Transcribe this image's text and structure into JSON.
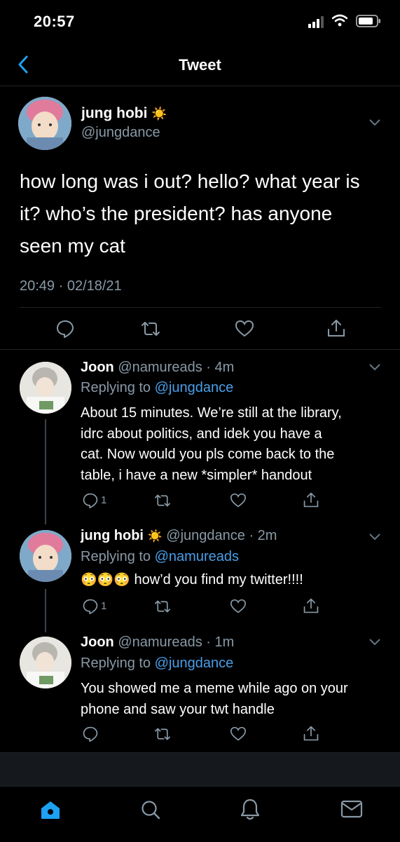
{
  "status_bar": {
    "time": "20:57"
  },
  "header": {
    "title": "Tweet"
  },
  "main_tweet": {
    "author_name": "jung hobi",
    "author_emoji": "☀️",
    "author_handle": "@jungdance",
    "text_lines": [
      "how long was i out? hello? what year is",
      "it? who’s the president? has anyone",
      "seen my cat"
    ],
    "timestamp": "20:49 · 02/18/21"
  },
  "replies": [
    {
      "author_name": "Joon",
      "author_handle": "@namureads",
      "time": "· 4m",
      "replying_prefix": "Replying to",
      "replying_to": "@jungdance",
      "text_lines": [
        "About 15 minutes. We’re still at the library,",
        "idrc about politics, and idek you have a",
        "cat. Now would you pls come back to the",
        "table, i have a new *simpler* handout"
      ],
      "reply_count": "1"
    },
    {
      "author_name": "jung hobi",
      "author_emoji": "☀️",
      "author_handle": "@jungdance",
      "time": "· 2m",
      "replying_prefix": "Replying to",
      "replying_to": "@namureads",
      "emojis": "😳😳😳",
      "text": "how’d you find my twitter!!!!",
      "reply_count": "1"
    },
    {
      "author_name": "Joon",
      "author_handle": "@namureads",
      "time": "· 1m",
      "replying_prefix": "Replying to",
      "replying_to": "@jungdance",
      "text_lines": [
        "You showed me a meme while ago on your",
        "phone and saw your twt handle"
      ],
      "reply_count": ""
    }
  ],
  "icons": {
    "reply": "speech-bubble",
    "retweet": "loop-arrows",
    "like": "heart",
    "share": "share-up",
    "nav": [
      "home-icon",
      "search-icon",
      "bell-icon",
      "mail-icon"
    ]
  },
  "colors": {
    "background": "#000000",
    "accent": "#1da1f2",
    "link": "#4a9ee8",
    "secondary": "#8899a6"
  }
}
